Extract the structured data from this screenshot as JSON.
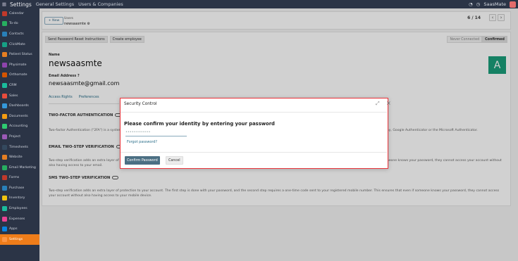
{
  "topbar": {
    "title": "Settings",
    "menus": [
      "General Settings",
      "Users & Companies"
    ],
    "user": "SaasMate"
  },
  "sidebar": {
    "items": [
      "Calendar",
      "To-do",
      "Contacts",
      "ClickMate",
      "Patient Status",
      "Physimate",
      "Orthomate",
      "CRM",
      "Sales",
      "Dashboards",
      "Documents",
      "Accounting",
      "Project",
      "Timesheets",
      "Website",
      "Email Marketing",
      "Forms",
      "Purchase",
      "Inventory",
      "Employees",
      "Expenses",
      "Apps",
      "Settings"
    ],
    "colors": [
      "#c0392b",
      "#27ae60",
      "#2980b9",
      "#16a085",
      "#e67e22",
      "#8e44ad",
      "#d35400",
      "#1abc9c",
      "#e74c3c",
      "#3498db",
      "#f39c12",
      "#2ecc71",
      "#9b59b6",
      "#34495e",
      "#e67e22",
      "#27ae60",
      "#c0392b",
      "#2980b9",
      "#f1c40f",
      "#1abc9c",
      "#e84393",
      "#0984e3",
      "#fd9644"
    ],
    "active": "Settings"
  },
  "control": {
    "new_label": "+ New",
    "crumb_parent": "Users",
    "crumb_current": "newsaasmte ⚙",
    "pager": "6 / 14",
    "prev": "‹",
    "next": "›"
  },
  "form": {
    "buttons": [
      "Send Password Reset Instructions",
      "Create employee"
    ],
    "status": [
      "Never Connected",
      "Confirmed"
    ],
    "name_label": "Name",
    "name": "newsaasmte",
    "email_label": "Email Address ?",
    "email": "newsaasmte@gmail.com",
    "avatar_letter": "A",
    "tabs": [
      "Access Rights",
      "Preferences"
    ],
    "sec1": "TWO-FACTOR AUTHENTICATION",
    "para1": "Two-factor Authentication (\"2FA\") is a system of double authentication. The first one is done with your password and the second one with a code you get from a dedicated mobile app. Popular ones include Authy, Google Authenticator or the Microsoft Authenticator.",
    "sec2": "EMAIL TWO-STEP VERIFICATION",
    "para2": "Two-step verification adds an extra layer of protection to your account. The first step is done with your password, and the second step requires a one-time code sent to your email. This ensures that even if someone knows your password, they cannot access your account without also having access to your email.",
    "sec3": "SMS TWO-STEP VERIFICATION",
    "para3": "Two-step verification adds an extra layer of protection to your account. The first step is done with your password, and the second step requires a one-time code sent to your registered mobile number. This ensures that even if someone knows your password, they cannot access your account without also having access to your mobile device."
  },
  "modal": {
    "title": "Security Control",
    "question": "Please confirm your identity by entering your password",
    "password_value": "••••••••••••",
    "forgot": "Forgot password?",
    "confirm": "Confirm Password",
    "cancel": "Cancel",
    "expand_icon": "⤢",
    "close_icon": "×"
  }
}
